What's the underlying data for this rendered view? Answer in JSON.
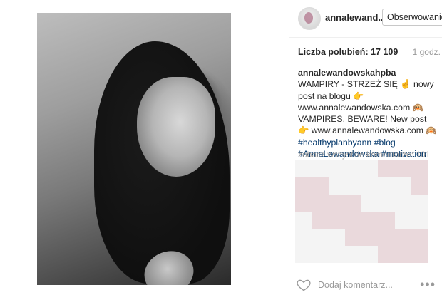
{
  "post": {
    "username": "annalewand...",
    "follow_label": "Obserwowanie",
    "likes_label": "Liczba polubień: 17 109",
    "time": "1 godz.",
    "caption": {
      "author": "annalewandowskahpba",
      "line1": " WAMPIRY - STRZEŻ SIĘ ☝ nowy post na blogu 👉 www.annalewandowska.com 🙉 VAMPIRES. BEWARE! New post 👉 www.annalewandowska.com 🙉",
      "tags": "#healthyplanbyann #blog #AnnaLewandowska #motivation #happy #lovelife #positive #foto @martawojtal"
    },
    "view_comments": "zobacz wszystkie komentarze: 101",
    "comment_placeholder": "Dodaj komentarz...",
    "more_label": "•••"
  },
  "colors": {
    "link": "#003569",
    "muted": "#999999",
    "border": "#efefef"
  },
  "icons": {
    "like": "heart-icon",
    "more": "more-options-icon"
  }
}
